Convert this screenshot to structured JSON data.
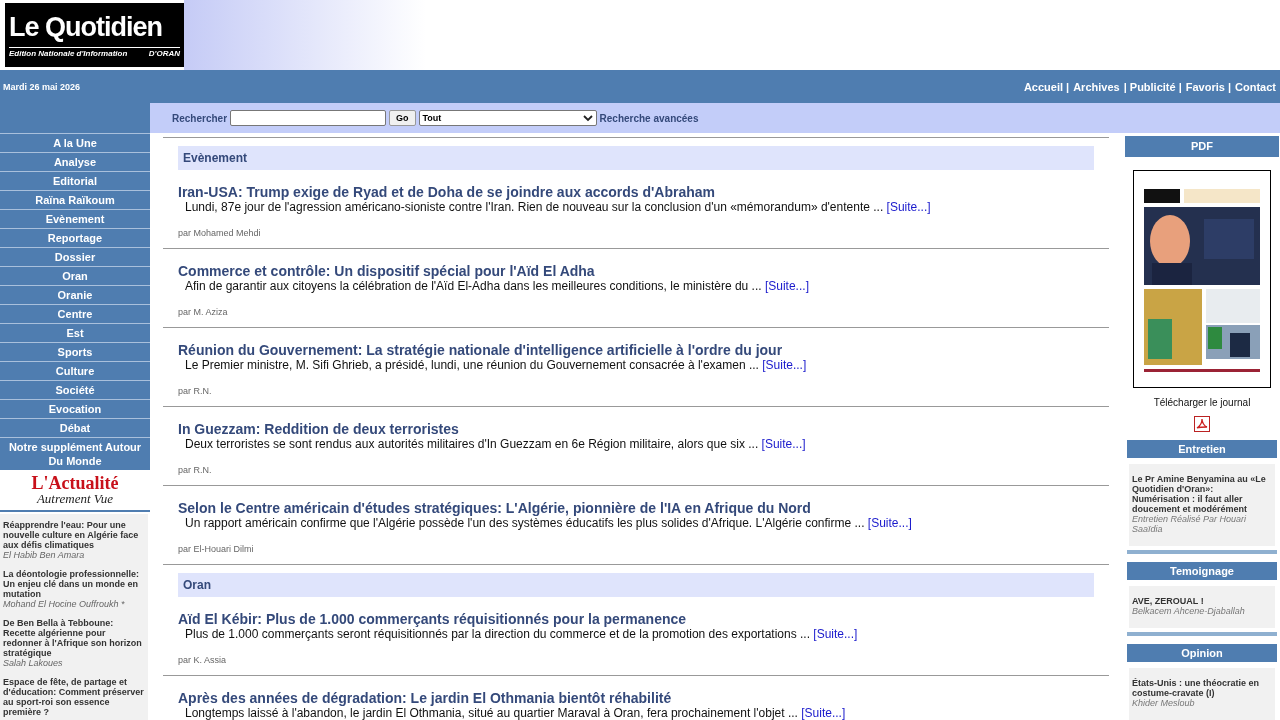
{
  "logo": {
    "title": "Le Quotidien",
    "subtitle": "Edition Nationale d'Information",
    "city": "D'ORAN"
  },
  "date": "Mardi 26 mai 2026",
  "top_links": [
    "Accueil |",
    "Archives",
    "| Publicité |",
    "Favoris |",
    "Contact"
  ],
  "search": {
    "label": "Rechercher",
    "button": "Go",
    "scope": "Tout",
    "advanced": "Recherche avancées"
  },
  "nav": [
    "A la Une",
    "Analyse",
    "Editorial",
    "Raïna Raïkoum",
    "Evènement",
    "Reportage",
    "Dossier",
    "Oran",
    "Oranie",
    "Centre",
    "Est",
    "Sports",
    "Culture",
    "Société",
    "Evocation",
    "Débat",
    "Notre supplément Autour Du Monde"
  ],
  "sidebar_logo": {
    "line1": "L'Actualité",
    "line2": "Autrement Vue"
  },
  "sidebar_articles": [
    {
      "title": "Réapprendre l'eau: Pour une nouvelle culture en Algérie face aux défis climatiques",
      "author": "El Habib Ben Amara"
    },
    {
      "title": "La déontologie professionnelle: Un enjeu clé dans un monde en mutation",
      "author": "Mohand El Hocine Ouffroukh *"
    },
    {
      "title": "De Ben Bella à Tebboune: Recette algérienne pour redonner à l'Afrique son horizon stratégique",
      "author": "Salah Lakoues"
    },
    {
      "title": "Espace de fête, de partage et d'éducation: Comment préserver au sport-roi son essence première ?"
    }
  ],
  "sections": [
    {
      "heading": "Evènement",
      "articles": [
        {
          "title": "Iran-USA: Trump exige de Ryad et de Doha de se joindre aux accords d'Abraham",
          "summary": "Lundi, 87e jour de l'agression américano-sioniste contre l'Iran. Rien de nouveau sur la conclusion d'un «mémorandum» d'entente ...",
          "more": "[Suite...]",
          "author": "par Mohamed Mehdi"
        },
        {
          "title": "Commerce et contrôle: Un dispositif spécial pour l'Aïd El Adha",
          "summary": "Afin de garantir aux citoyens la célébration de l'Aïd El-Adha dans les meilleures conditions, le ministère du ...",
          "more": "[Suite...]",
          "author": "par M. Aziza"
        },
        {
          "title": "Réunion du Gouvernement: La stratégie nationale d'intelligence artificielle à l'ordre du jour",
          "summary": "Le Premier ministre, M. Sifi Ghrieb, a présidé, lundi, une réunion du Gouvernement consacrée à l'examen ...",
          "more": "[Suite...]",
          "author": "par R.N."
        },
        {
          "title": "In Guezzam: Reddition de deux terroristes",
          "summary": "Deux terroristes se sont rendus aux autorités militaires d'In Guezzam en 6e Région militaire, alors que six ...",
          "more": "[Suite...]",
          "author": "par R.N."
        },
        {
          "title": "Selon le Centre américain d'études stratégiques: L'Algérie, pionnière de l'IA en Afrique du Nord",
          "summary": "Un rapport américain confirme que l'Algérie possède l'un des systèmes éducatifs les plus solides d'Afrique. L'Algérie confirme ...",
          "more": "[Suite...]",
          "author": "par El-Houari Dilmi"
        }
      ]
    },
    {
      "heading": "Oran",
      "articles": [
        {
          "title": "Aïd El Kébir: Plus de 1.000 commerçants réquisitionnés pour la permanence",
          "summary": "Plus de 1.000 commerçants seront réquisitionnés par la direction du commerce et de la promotion des exportations ...",
          "more": "[Suite...]",
          "author": "par K. Assia"
        },
        {
          "title": "Après des années de dégradation: Le jardin El Othmania bientôt réhabilité",
          "summary": "Longtemps laissé à l'abandon, le jardin El Othmania, situé au quartier Maraval à Oran, fera prochainement l'objet ...",
          "more": "[Suite...]"
        }
      ]
    }
  ],
  "right": {
    "pdf": "PDF",
    "download": "Télécharger le journal",
    "boxes": [
      {
        "heading": "Entretien",
        "title": "Le Pr Amine Benyamina au «Le Quotidien d'Oran»: Numérisation : il faut aller doucement et modérément",
        "author": "Entretien Réalisé Par Houari Saaïdia"
      },
      {
        "heading": "Temoignage",
        "title": "AVE, ZEROUAL !",
        "author": "Belkacem Ahcene-Djaballah"
      },
      {
        "heading": "Opinion",
        "title": "États-Unis : une théocratie en costume-cravate (I)",
        "author": "Khider Mesloub"
      }
    ]
  }
}
